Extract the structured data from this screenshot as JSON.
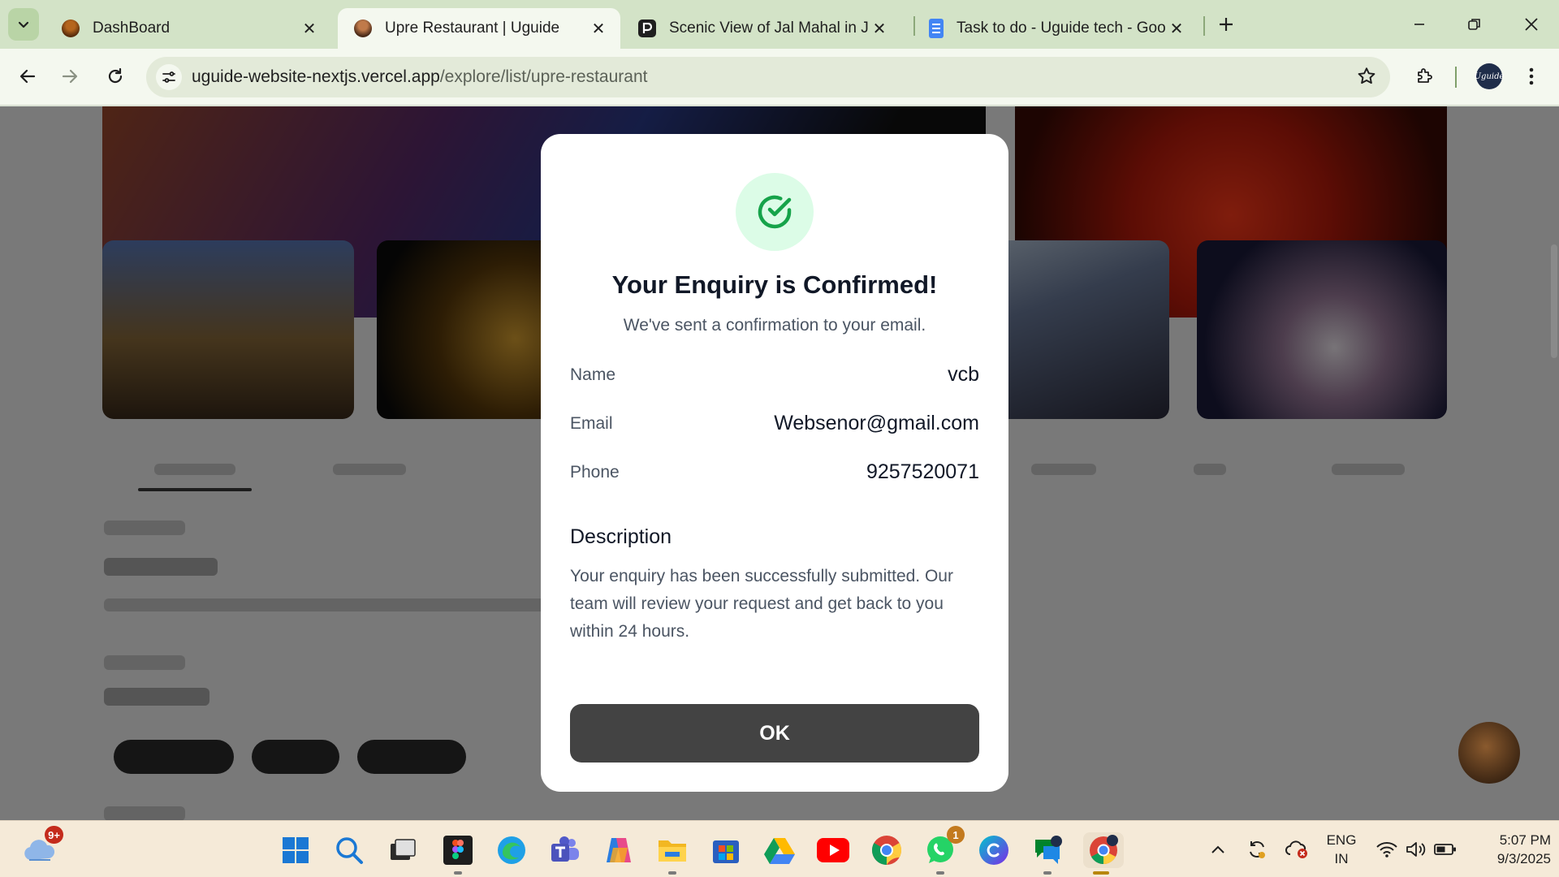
{
  "browser": {
    "tabs": [
      {
        "title": "DashBoard",
        "favicon": "dashboard-avatar-icon",
        "active": false
      },
      {
        "title": "Upre Restaurant | Uguide",
        "favicon": "restaurant-avatar-icon",
        "active": true
      },
      {
        "title": "Scenic View of Jal Mahal in Jaipur",
        "favicon": "p-logo-icon",
        "active": false
      },
      {
        "title": "Task to do - Uguide tech - Google Docs",
        "favicon": "google-docs-icon",
        "active": false
      }
    ],
    "url": {
      "host": "uguide-website-nextjs.vercel.app",
      "path": "/explore/list/upre-restaurant"
    },
    "profile_initials": "Uguide"
  },
  "modal": {
    "icon": "check-circle-icon",
    "title": "Your Enquiry is Confirmed!",
    "subtitle": "We've sent a confirmation to your email.",
    "details": [
      {
        "label": "Name",
        "value": "vcb"
      },
      {
        "label": "Email",
        "value": "Websenor@gmail.com"
      },
      {
        "label": "Phone",
        "value": "9257520071"
      }
    ],
    "description_title": "Description",
    "description_text": "Your enquiry has been successfully submitted. Our team will review your request and get back to you within 24 hours.",
    "ok_label": "OK",
    "accent_color": "#22c55e",
    "button_color": "#434343"
  },
  "taskbar": {
    "weather_badge": "9+",
    "apps": [
      "windows-start-icon",
      "search-icon",
      "task-view-icon",
      "figma-icon",
      "edge-icon",
      "teams-icon",
      "copilot-icon",
      "file-explorer-icon",
      "microsoft-store-icon",
      "google-drive-icon",
      "youtube-icon",
      "chrome-icon",
      "whatsapp-icon",
      "canva-icon",
      "chat-app-icon",
      "chrome-profile-icon"
    ],
    "whatsapp_badge": "1",
    "language": {
      "line1": "ENG",
      "line2": "IN"
    },
    "time": "5:07 PM",
    "date": "9/3/2025"
  }
}
